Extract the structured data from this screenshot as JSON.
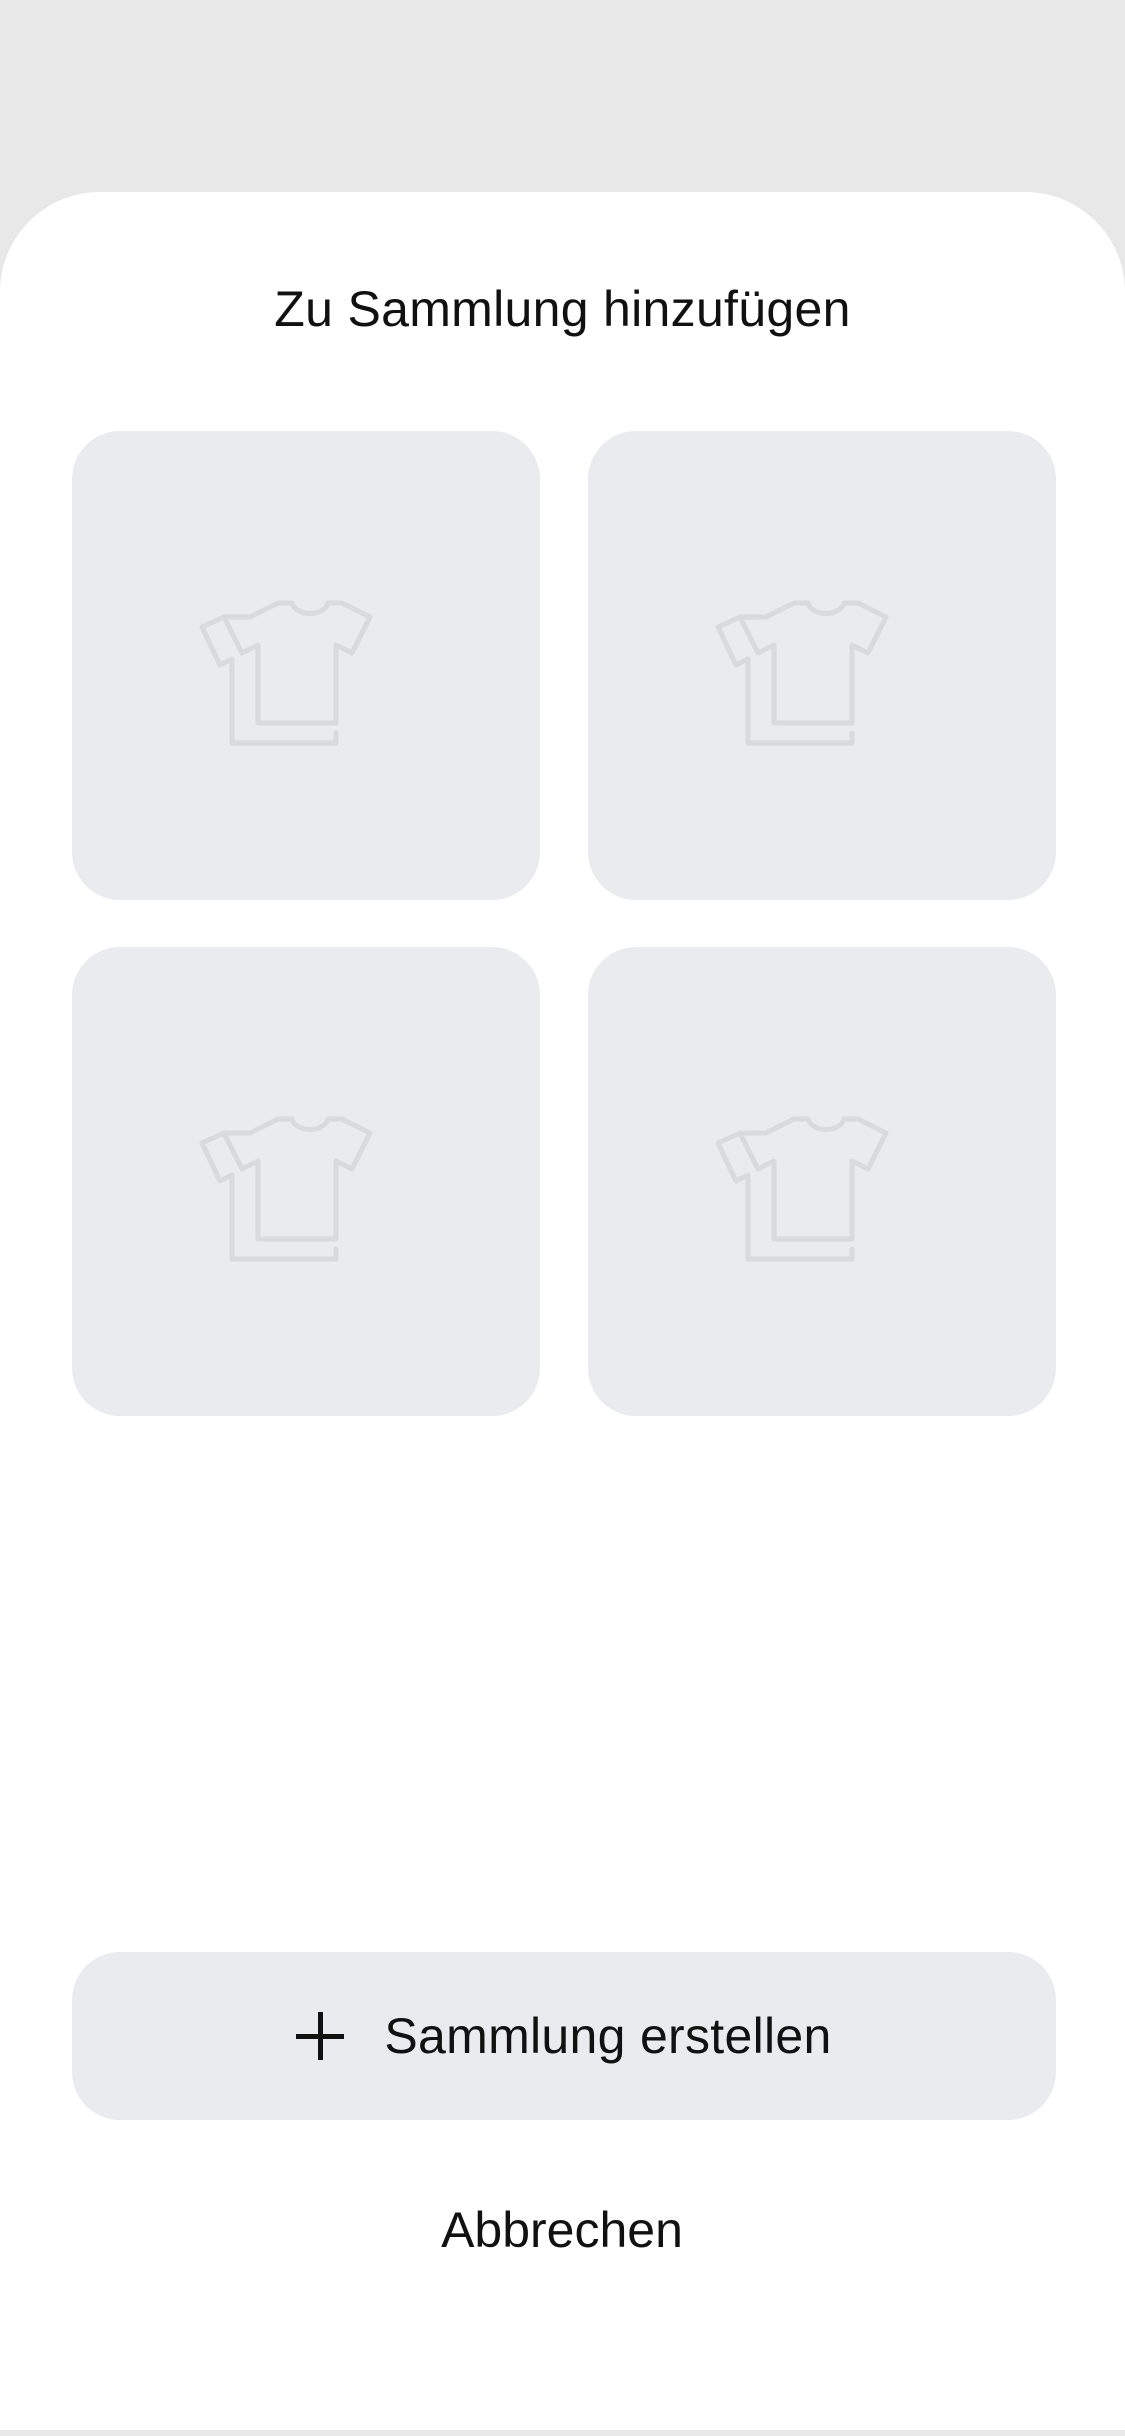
{
  "sheet": {
    "title": "Zu Sammlung hinzufügen"
  },
  "collections": [
    {
      "icon": "tshirt-stack-icon"
    },
    {
      "icon": "tshirt-stack-icon"
    },
    {
      "icon": "tshirt-stack-icon"
    },
    {
      "icon": "tshirt-stack-icon"
    }
  ],
  "actions": {
    "create_label": "Sammlung erstellen",
    "create_icon": "plus-icon",
    "cancel_label": "Abbrechen"
  },
  "colors": {
    "backdrop": "#e8e8e8",
    "sheet": "#ffffff",
    "tile": "#e9ebee",
    "icon_stroke": "#d8dadd",
    "text": "#111111"
  }
}
